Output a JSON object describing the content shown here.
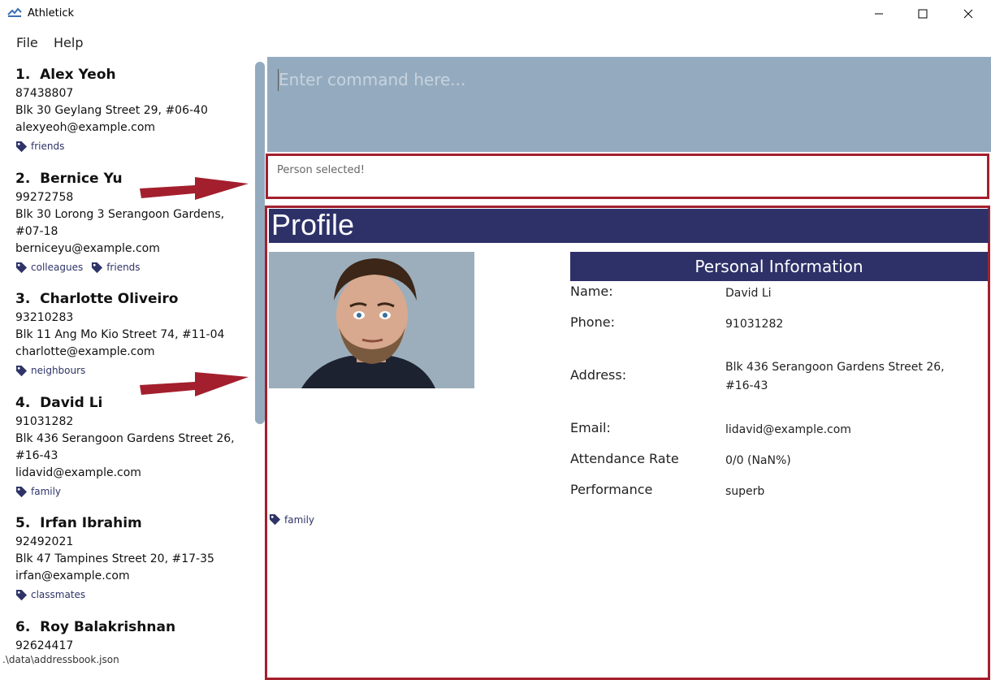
{
  "window": {
    "title": "Athletick"
  },
  "menu": {
    "file": "File",
    "help": "Help"
  },
  "persons": [
    {
      "index": "1.",
      "name": "Alex Yeoh",
      "phone": "87438807",
      "address_lines": [
        "Blk 30 Geylang Street 29, #06-40"
      ],
      "email": "alexyeoh@example.com",
      "tags": [
        "friends"
      ]
    },
    {
      "index": "2.",
      "name": "Bernice Yu",
      "phone": "99272758",
      "address_lines": [
        "Blk 30 Lorong 3 Serangoon Gardens,",
        "#07-18"
      ],
      "email": "berniceyu@example.com",
      "tags": [
        "colleagues",
        "friends"
      ]
    },
    {
      "index": "3.",
      "name": "Charlotte Oliveiro",
      "phone": "93210283",
      "address_lines": [
        "Blk 11 Ang Mo Kio Street 74, #11-04"
      ],
      "email": "charlotte@example.com",
      "tags": [
        "neighbours"
      ]
    },
    {
      "index": "4.",
      "name": "David Li",
      "phone": "91031282",
      "address_lines": [
        "Blk 436 Serangoon Gardens Street 26,",
        "#16-43"
      ],
      "email": "lidavid@example.com",
      "tags": [
        "family"
      ]
    },
    {
      "index": "5.",
      "name": "Irfan Ibrahim",
      "phone": "92492021",
      "address_lines": [
        "Blk 47 Tampines Street 20, #17-35"
      ],
      "email": "irfan@example.com",
      "tags": [
        "classmates"
      ]
    },
    {
      "index": "6.",
      "name": "Roy Balakrishnan",
      "phone": "92624417"
    }
  ],
  "status_bar": {
    "path": ".\\data\\addressbook.json"
  },
  "command": {
    "placeholder": "Enter command here..."
  },
  "result": {
    "message": "Person selected!"
  },
  "profile": {
    "title": "Profile",
    "info_header": "Personal Information",
    "fields": {
      "name": {
        "label": "Name:",
        "value": "David Li"
      },
      "phone": {
        "label": "Phone:",
        "value": "91031282"
      },
      "address": {
        "label": "Address:",
        "value_lines": [
          "Blk 436 Serangoon Gardens Street 26,",
          "#16-43"
        ]
      },
      "email": {
        "label": "Email:",
        "value": "lidavid@example.com"
      },
      "attendance": {
        "label": "Attendance Rate",
        "value": "0/0 (NaN%)"
      },
      "performance": {
        "label": "Performance",
        "value": "superb"
      }
    },
    "tag": "family"
  },
  "colors": {
    "accent": "#2e3168",
    "command_bg": "#94abbf",
    "highlight_border": "#a31f2d",
    "tag_text": "#2e3468"
  }
}
